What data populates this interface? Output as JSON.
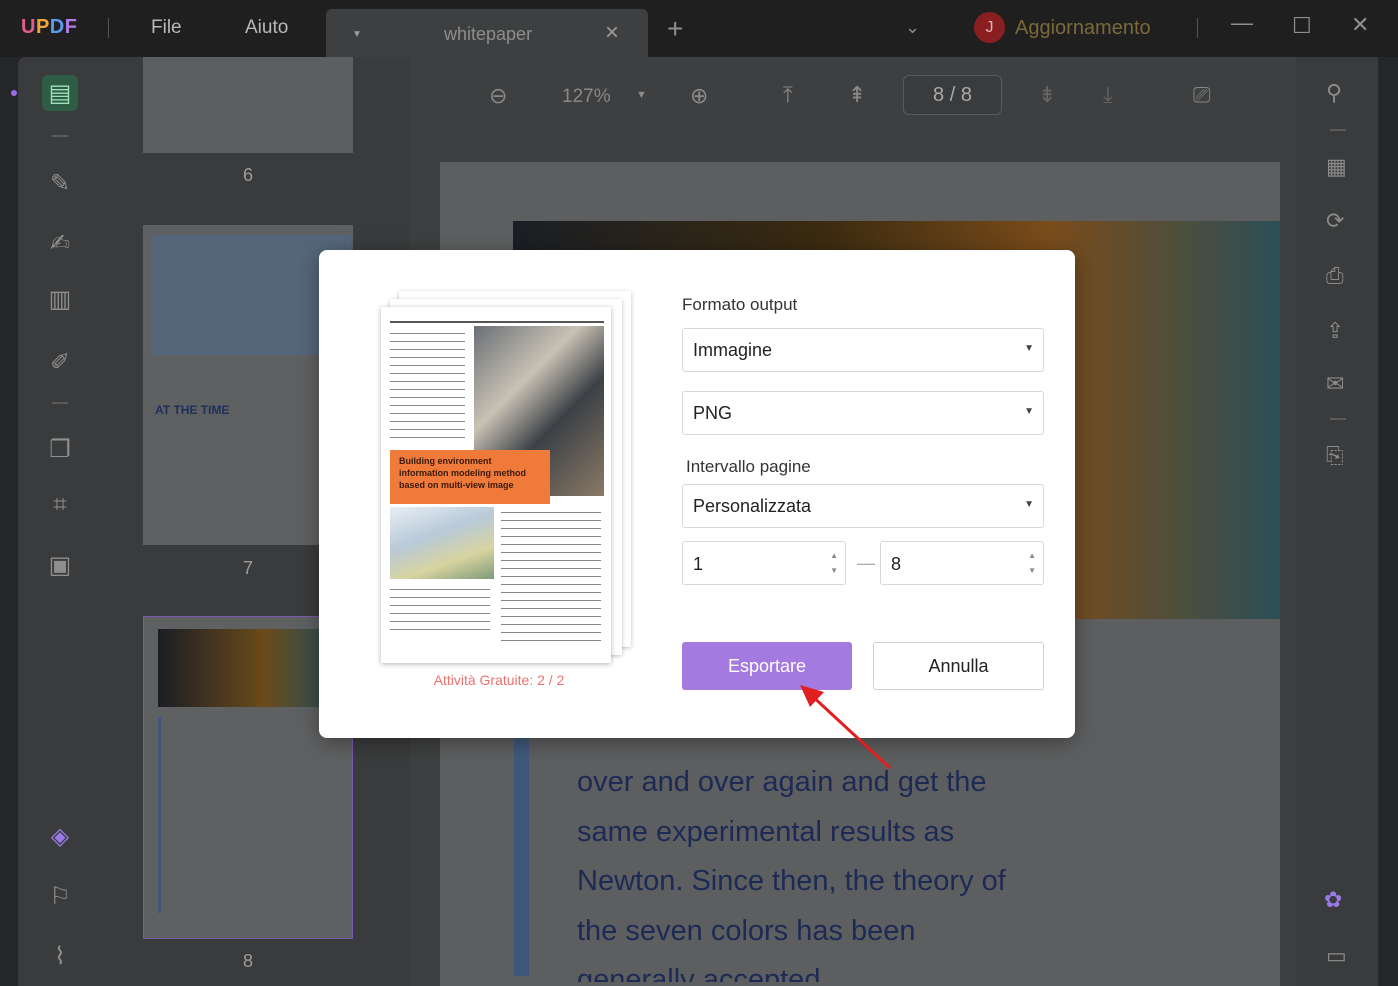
{
  "app": {
    "logo": "UPDF",
    "menu": [
      "File",
      "Aiuto"
    ],
    "tab_name": "whitepaper",
    "avatar_letter": "J",
    "upgrade_label": "Aggiornamento"
  },
  "toolbar": {
    "zoom": "127%",
    "page_indicator": "8 / 8"
  },
  "thumbnails": {
    "page_numbers": [
      "6",
      "7",
      "8"
    ],
    "page7_heading": "AT THE TIME"
  },
  "document": {
    "lines": [
      "over and over again and get the",
      "same experimental results as",
      "Newton. Since then, the theory of",
      "the seven colors has been",
      "generally accepted"
    ]
  },
  "dialog": {
    "preview_banner": "Building environment information modeling method based on multi-view image",
    "free_tasks": "Attività Gratuite: 2 / 2",
    "output_format_label": "Formato output",
    "output_format_value": "Immagine",
    "image_type_value": "PNG",
    "page_range_label": "Intervallo pagine",
    "page_range_value": "Personalizzata",
    "range_from": "1",
    "range_to": "8",
    "export_button": "Esportare",
    "cancel_button": "Annulla"
  },
  "colors": {
    "accent": "#a47ae0",
    "warning_text": "#f07070",
    "arrow": "#e02020"
  }
}
